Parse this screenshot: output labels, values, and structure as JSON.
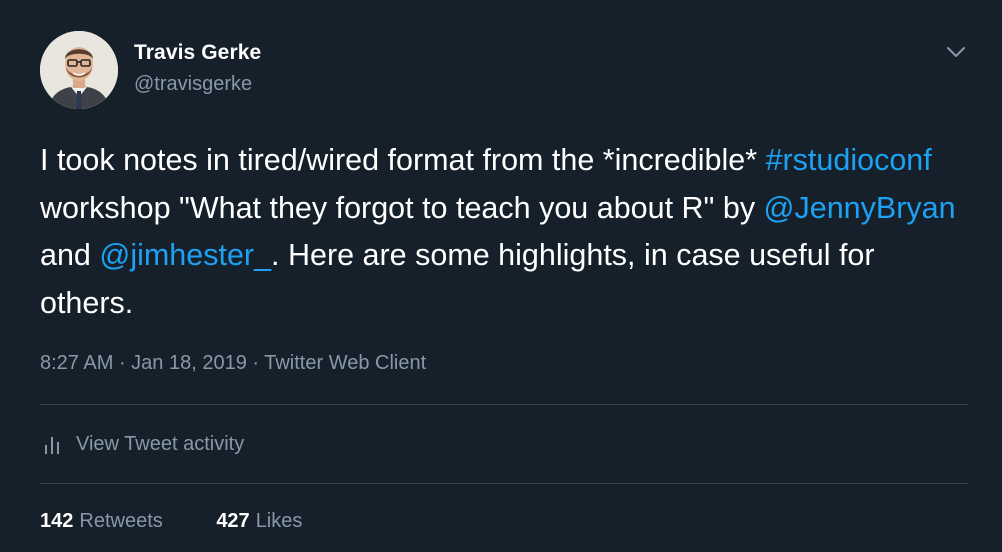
{
  "tweet": {
    "author": {
      "display_name": "Travis Gerke",
      "handle": "@travisgerke"
    },
    "text": {
      "part1": "I took notes in tired/wired format from the *incredible* ",
      "hashtag": "#rstudioconf",
      "part2": " workshop \"What they forgot to teach you about R\" by ",
      "mention1": "@JennyBryan",
      "part3": " and ",
      "mention2": "@jimhester_",
      "part4": ". Here are some highlights, in case useful for others."
    },
    "meta": {
      "time": "8:27 AM",
      "separator": " · ",
      "date": "Jan 18, 2019",
      "source": "Twitter Web Client"
    },
    "activity_label": "View Tweet activity",
    "stats": {
      "retweets_count": "142",
      "retweets_label": "Retweets",
      "likes_count": "427",
      "likes_label": "Likes"
    },
    "icons": {
      "caret": "chevron-down-icon",
      "activity": "bar-chart-icon"
    },
    "colors": {
      "background": "#15202b",
      "link": "#1da1f2",
      "secondary_text": "#8899a6",
      "divider": "#38444d"
    }
  }
}
